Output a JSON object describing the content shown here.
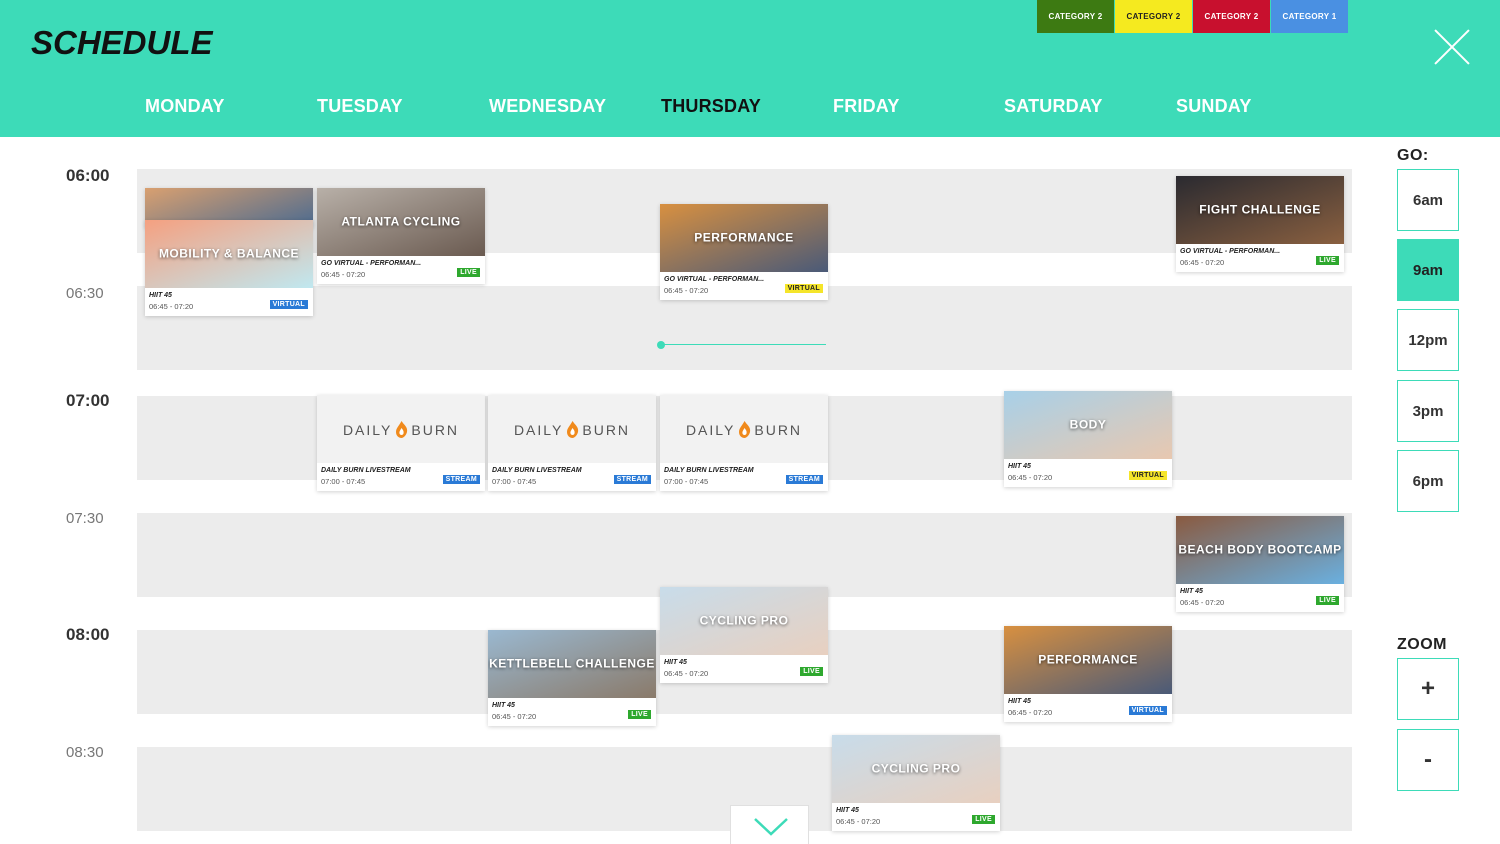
{
  "header": {
    "title": "SCHEDULE",
    "categories": [
      {
        "label": "CATEGORY 2",
        "bg": "#3d7a12",
        "fg": "#ffffff"
      },
      {
        "label": "CATEGORY 2",
        "bg": "#f5ea1f",
        "fg": "#222222"
      },
      {
        "label": "CATEGORY 2",
        "bg": "#c8102e",
        "fg": "#ffffff"
      },
      {
        "label": "CATEGORY 1",
        "bg": "#4a90e2",
        "fg": "#ffffff"
      }
    ],
    "close_icon": "close-icon"
  },
  "days": [
    {
      "label": "MONDAY",
      "active": false
    },
    {
      "label": "TUESDAY",
      "active": false
    },
    {
      "label": "WEDNESDAY",
      "active": false
    },
    {
      "label": "THURSDAY",
      "active": true
    },
    {
      "label": "FRIDAY",
      "active": false
    },
    {
      "label": "SATURDAY",
      "active": false
    },
    {
      "label": "SUNDAY",
      "active": false
    }
  ],
  "times": [
    "06:00",
    "06:30",
    "07:00",
    "07:30",
    "08:00",
    "08:30"
  ],
  "events": [
    {
      "day": 0,
      "thumb": "",
      "name": "",
      "time": "",
      "badge": "",
      "thumb_colors": [
        "#d9a070",
        "#4a6a90"
      ]
    },
    {
      "day": 0,
      "thumb": "MOBILITY & BALANCE",
      "name": "HIIT 45",
      "time": "06:45 - 07:20",
      "badge": "VIRTUAL",
      "badge_type": "virtual-blue",
      "thumb_colors": [
        "#f5a080",
        "#c0e8f0"
      ]
    },
    {
      "day": 1,
      "thumb": "ATLANTA CYCLING",
      "name": "GO VIRTUAL - PERFORMAN...",
      "time": "06:45 - 07:20",
      "badge": "LIVE",
      "badge_type": "live",
      "thumb_colors": [
        "#b8b0a8",
        "#6a5a50"
      ]
    },
    {
      "day": 3,
      "thumb": "PERFORMANCE",
      "name": "GO VIRTUAL - PERFORMAN...",
      "time": "06:45 - 07:20",
      "badge": "VIRTUAL",
      "badge_type": "virtual-yellow",
      "thumb_colors": [
        "#d89040",
        "#4a5a78"
      ]
    },
    {
      "day": 6,
      "thumb": "FIGHT CHALLENGE",
      "name": "GO VIRTUAL - PERFORMAN...",
      "time": "06:45 - 07:20",
      "badge": "LIVE",
      "badge_type": "live",
      "thumb_colors": [
        "#2a2a30",
        "#8a6040"
      ]
    },
    {
      "day": 1,
      "thumb": "DAILYBURN",
      "name": "DAILY BURN LIVESTREAM",
      "time": "07:00 - 07:45",
      "badge": "STREAM",
      "badge_type": "stream"
    },
    {
      "day": 2,
      "thumb": "DAILYBURN",
      "name": "DAILY BURN LIVESTREAM",
      "time": "07:00 - 07:45",
      "badge": "STREAM",
      "badge_type": "stream"
    },
    {
      "day": 3,
      "thumb": "DAILYBURN",
      "name": "DAILY BURN LIVESTREAM",
      "time": "07:00 - 07:45",
      "badge": "STREAM",
      "badge_type": "stream"
    },
    {
      "day": 5,
      "thumb": "BODY",
      "name": "HIIT 45",
      "time": "06:45 - 07:20",
      "badge": "VIRTUAL",
      "badge_type": "virtual-yellow",
      "thumb_colors": [
        "#a8d0e8",
        "#e8c8b0"
      ]
    },
    {
      "day": 6,
      "thumb": "BEACH BODY BOOTCAMP",
      "name": "HIIT 45",
      "time": "06:45 - 07:20",
      "badge": "LIVE",
      "badge_type": "live",
      "thumb_colors": [
        "#8a5a40",
        "#6ab0e0"
      ]
    },
    {
      "day": 3,
      "thumb": "CYCLING PRO",
      "name": "HIIT 45",
      "time": "06:45 - 07:20",
      "badge": "LIVE",
      "badge_type": "live",
      "thumb_colors": [
        "#c8dcea",
        "#e8d0c0"
      ]
    },
    {
      "day": 2,
      "thumb": "KETTLEBELL CHALLENGE",
      "name": "HIIT 45",
      "time": "06:45 - 07:20",
      "badge": "LIVE",
      "badge_type": "live",
      "thumb_colors": [
        "#9ab8d0",
        "#8a7a6a"
      ]
    },
    {
      "day": 5,
      "thumb": "PERFORMANCE",
      "name": "HIIT 45",
      "time": "06:45 - 07:20",
      "badge": "VIRTUAL",
      "badge_type": "virtual-blue",
      "thumb_colors": [
        "#d89040",
        "#4a5a78"
      ]
    },
    {
      "day": 4,
      "thumb": "CYCLING PRO",
      "name": "HIIT 45",
      "time": "06:45 - 07:20",
      "badge": "LIVE",
      "badge_type": "live",
      "thumb_colors": [
        "#c8dcea",
        "#e8d0c0"
      ]
    }
  ],
  "panel": {
    "go_label": "GO:",
    "go_options": [
      {
        "label": "6am",
        "active": false
      },
      {
        "label": "9am",
        "active": true
      },
      {
        "label": "12pm",
        "active": false
      },
      {
        "label": "3pm",
        "active": false
      },
      {
        "label": "6pm",
        "active": false
      }
    ],
    "zoom_label": "ZOOM",
    "zoom_in": "+",
    "zoom_out": "-"
  },
  "colors": {
    "accent": "#3ddbb8"
  }
}
